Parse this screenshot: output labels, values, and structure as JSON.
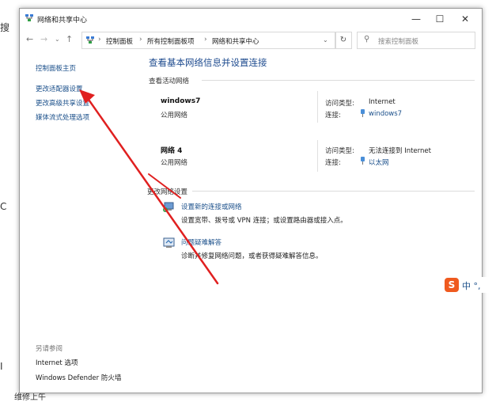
{
  "window": {
    "title": "网络和共享中心",
    "controls": {
      "minimize": "—",
      "maximize": "☐",
      "close": "✕"
    }
  },
  "address": {
    "crumbs": [
      "控制面板",
      "所有控制面板项",
      "网络和共享中心"
    ],
    "search_placeholder": "搜索控制面板"
  },
  "sidebar": {
    "links": [
      "控制面板主页",
      "更改适配器设置",
      "更改高级共享设置",
      "媒体流式处理选项"
    ],
    "see_also_title": "另请参阅",
    "see_also": [
      "Internet 选项",
      "Windows Defender 防火墙"
    ]
  },
  "main": {
    "title": "查看基本网络信息并设置连接",
    "active_networks_label": "查看活动网络",
    "networks": [
      {
        "name": "windows7",
        "type": "公用网络",
        "access_label": "访问类型:",
        "access_value": "Internet",
        "conn_label": "连接:",
        "conn_value": "windows7"
      },
      {
        "name": "网络 4",
        "type": "公用网络",
        "access_label": "访问类型:",
        "access_value": "无法连接到 Internet",
        "conn_label": "连接:",
        "conn_value": "以太网"
      }
    ],
    "change_settings_label": "更改网络设置",
    "tasks": [
      {
        "link": "设置新的连接或网络",
        "desc": "设置宽带、拨号或 VPN 连接；或设置路由器或接入点。"
      },
      {
        "link": "问题疑难解答",
        "desc": "诊断并修复网络问题，或者获得疑难解答信息。"
      }
    ]
  },
  "ime": {
    "logo": "S",
    "text": "中 °,"
  },
  "background": {
    "fragments": [
      "搜",
      "C",
      "I",
      "维修上午"
    ]
  },
  "colors": {
    "link": "#1a4f8a",
    "title": "#1e4b8f",
    "arrow": "#e02020"
  }
}
